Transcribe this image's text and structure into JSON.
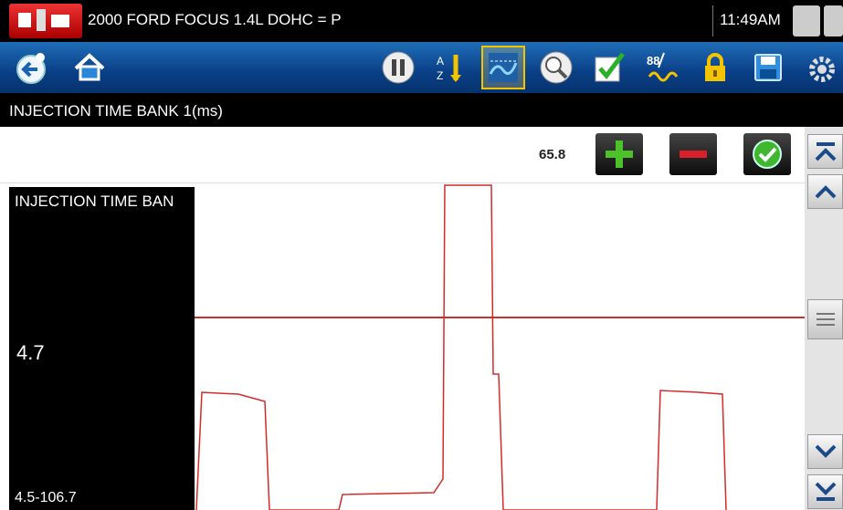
{
  "header": {
    "vehicle_title": "2000 FORD FOCUS 1.4L DOHC = P",
    "time": "11:49AM"
  },
  "toolbar": {
    "buttons": [
      "back-icon",
      "home-icon",
      "pause-icon",
      "sort-icon",
      "graph-view-icon",
      "zoom-icon",
      "checkmark-icon",
      "threshold-icon",
      "lock-icon",
      "save-icon",
      "settings-icon"
    ]
  },
  "parameter": {
    "name": "INJECTION TIME BANK 1(ms)"
  },
  "graph_controls": {
    "scale_value": "65.8"
  },
  "panel": {
    "title": "INJECTION TIME BAN",
    "current_value": "4.7",
    "range": "4.5-106.7"
  },
  "colors": {
    "accent": "#f4c400",
    "trace": "#d42a2a",
    "toolbar": "#0a3f86"
  }
}
